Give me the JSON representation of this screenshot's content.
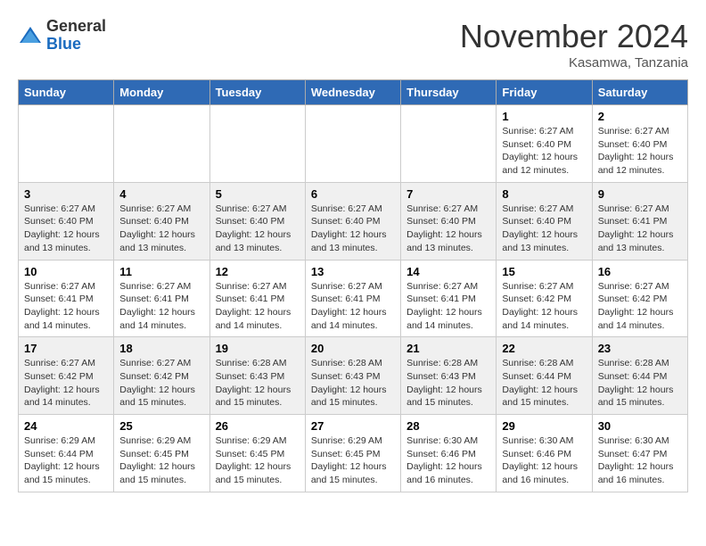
{
  "logo": {
    "general": "General",
    "blue": "Blue"
  },
  "title": "November 2024",
  "location": "Kasamwa, Tanzania",
  "days_header": [
    "Sunday",
    "Monday",
    "Tuesday",
    "Wednesday",
    "Thursday",
    "Friday",
    "Saturday"
  ],
  "weeks": [
    {
      "bg": "white",
      "days": [
        {
          "num": "",
          "info": ""
        },
        {
          "num": "",
          "info": ""
        },
        {
          "num": "",
          "info": ""
        },
        {
          "num": "",
          "info": ""
        },
        {
          "num": "",
          "info": ""
        },
        {
          "num": "1",
          "info": "Sunrise: 6:27 AM\nSunset: 6:40 PM\nDaylight: 12 hours\nand 12 minutes."
        },
        {
          "num": "2",
          "info": "Sunrise: 6:27 AM\nSunset: 6:40 PM\nDaylight: 12 hours\nand 12 minutes."
        }
      ]
    },
    {
      "bg": "gray",
      "days": [
        {
          "num": "3",
          "info": "Sunrise: 6:27 AM\nSunset: 6:40 PM\nDaylight: 12 hours\nand 13 minutes."
        },
        {
          "num": "4",
          "info": "Sunrise: 6:27 AM\nSunset: 6:40 PM\nDaylight: 12 hours\nand 13 minutes."
        },
        {
          "num": "5",
          "info": "Sunrise: 6:27 AM\nSunset: 6:40 PM\nDaylight: 12 hours\nand 13 minutes."
        },
        {
          "num": "6",
          "info": "Sunrise: 6:27 AM\nSunset: 6:40 PM\nDaylight: 12 hours\nand 13 minutes."
        },
        {
          "num": "7",
          "info": "Sunrise: 6:27 AM\nSunset: 6:40 PM\nDaylight: 12 hours\nand 13 minutes."
        },
        {
          "num": "8",
          "info": "Sunrise: 6:27 AM\nSunset: 6:40 PM\nDaylight: 12 hours\nand 13 minutes."
        },
        {
          "num": "9",
          "info": "Sunrise: 6:27 AM\nSunset: 6:41 PM\nDaylight: 12 hours\nand 13 minutes."
        }
      ]
    },
    {
      "bg": "white",
      "days": [
        {
          "num": "10",
          "info": "Sunrise: 6:27 AM\nSunset: 6:41 PM\nDaylight: 12 hours\nand 14 minutes."
        },
        {
          "num": "11",
          "info": "Sunrise: 6:27 AM\nSunset: 6:41 PM\nDaylight: 12 hours\nand 14 minutes."
        },
        {
          "num": "12",
          "info": "Sunrise: 6:27 AM\nSunset: 6:41 PM\nDaylight: 12 hours\nand 14 minutes."
        },
        {
          "num": "13",
          "info": "Sunrise: 6:27 AM\nSunset: 6:41 PM\nDaylight: 12 hours\nand 14 minutes."
        },
        {
          "num": "14",
          "info": "Sunrise: 6:27 AM\nSunset: 6:41 PM\nDaylight: 12 hours\nand 14 minutes."
        },
        {
          "num": "15",
          "info": "Sunrise: 6:27 AM\nSunset: 6:42 PM\nDaylight: 12 hours\nand 14 minutes."
        },
        {
          "num": "16",
          "info": "Sunrise: 6:27 AM\nSunset: 6:42 PM\nDaylight: 12 hours\nand 14 minutes."
        }
      ]
    },
    {
      "bg": "gray",
      "days": [
        {
          "num": "17",
          "info": "Sunrise: 6:27 AM\nSunset: 6:42 PM\nDaylight: 12 hours\nand 14 minutes."
        },
        {
          "num": "18",
          "info": "Sunrise: 6:27 AM\nSunset: 6:42 PM\nDaylight: 12 hours\nand 15 minutes."
        },
        {
          "num": "19",
          "info": "Sunrise: 6:28 AM\nSunset: 6:43 PM\nDaylight: 12 hours\nand 15 minutes."
        },
        {
          "num": "20",
          "info": "Sunrise: 6:28 AM\nSunset: 6:43 PM\nDaylight: 12 hours\nand 15 minutes."
        },
        {
          "num": "21",
          "info": "Sunrise: 6:28 AM\nSunset: 6:43 PM\nDaylight: 12 hours\nand 15 minutes."
        },
        {
          "num": "22",
          "info": "Sunrise: 6:28 AM\nSunset: 6:44 PM\nDaylight: 12 hours\nand 15 minutes."
        },
        {
          "num": "23",
          "info": "Sunrise: 6:28 AM\nSunset: 6:44 PM\nDaylight: 12 hours\nand 15 minutes."
        }
      ]
    },
    {
      "bg": "white",
      "days": [
        {
          "num": "24",
          "info": "Sunrise: 6:29 AM\nSunset: 6:44 PM\nDaylight: 12 hours\nand 15 minutes."
        },
        {
          "num": "25",
          "info": "Sunrise: 6:29 AM\nSunset: 6:45 PM\nDaylight: 12 hours\nand 15 minutes."
        },
        {
          "num": "26",
          "info": "Sunrise: 6:29 AM\nSunset: 6:45 PM\nDaylight: 12 hours\nand 15 minutes."
        },
        {
          "num": "27",
          "info": "Sunrise: 6:29 AM\nSunset: 6:45 PM\nDaylight: 12 hours\nand 15 minutes."
        },
        {
          "num": "28",
          "info": "Sunrise: 6:30 AM\nSunset: 6:46 PM\nDaylight: 12 hours\nand 16 minutes."
        },
        {
          "num": "29",
          "info": "Sunrise: 6:30 AM\nSunset: 6:46 PM\nDaylight: 12 hours\nand 16 minutes."
        },
        {
          "num": "30",
          "info": "Sunrise: 6:30 AM\nSunset: 6:47 PM\nDaylight: 12 hours\nand 16 minutes."
        }
      ]
    }
  ]
}
